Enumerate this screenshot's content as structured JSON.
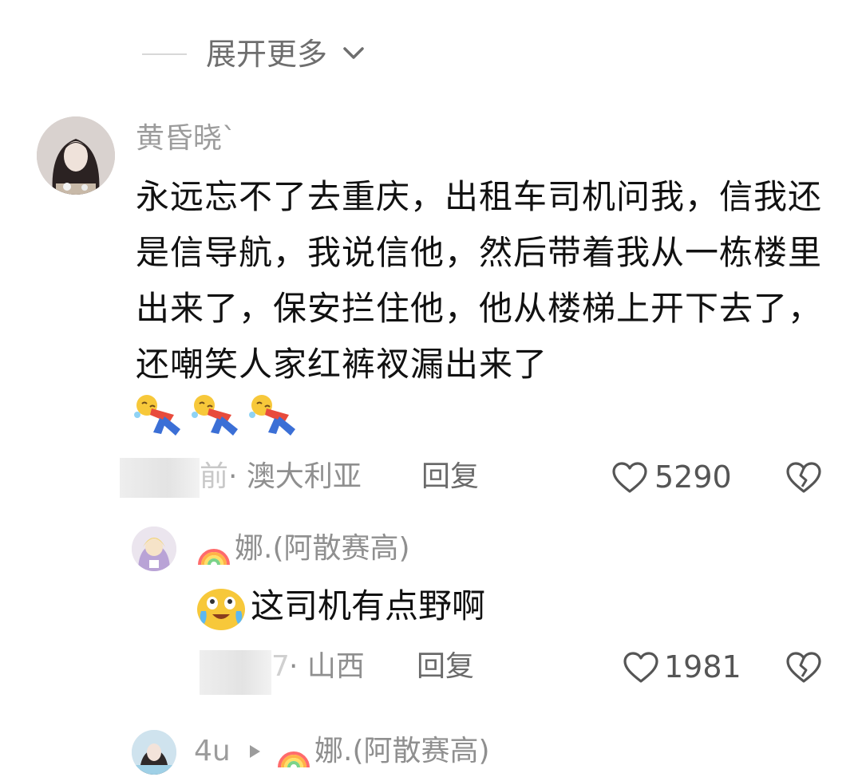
{
  "expand": {
    "label": "展开更多"
  },
  "main_comment": {
    "username": "黄昏晓`",
    "text": "永远忘不了去重庆，出租车司机问我，信我还是信导航，我说信他，然后带着我从一栋楼里出来了，保安拦住他，他从楼梯上开下去了，还嘲笑人家红裤衩漏出来了",
    "emojis": [
      "rolling-laugh-emoji",
      "rolling-laugh-emoji",
      "rolling-laugh-emoji"
    ],
    "time_partial": "前",
    "location": "· 澳大利亚",
    "reply_label": "回复",
    "likes": "5290"
  },
  "reply_1": {
    "username": "娜.(阿散赛高)",
    "text": "这司机有点野啊",
    "time_partial": "7",
    "location": "· 山西",
    "reply_label": "回复",
    "likes": "1981"
  },
  "reply_2": {
    "username": "4u",
    "reply_to": "娜.(阿散赛高)"
  },
  "colors": {
    "text": "#111111",
    "meta": "#8f8f8f",
    "icon": "#555555"
  }
}
